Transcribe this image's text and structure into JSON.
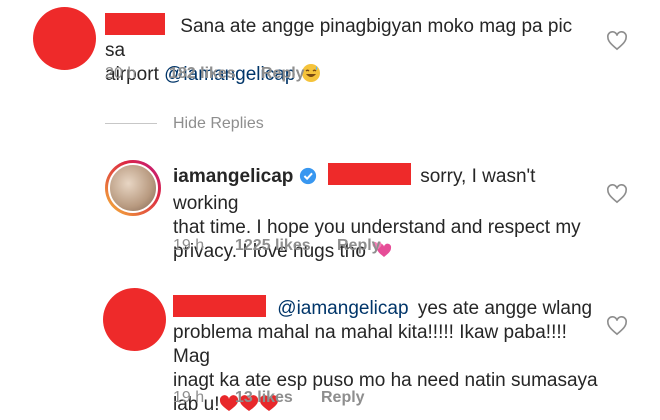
{
  "comments": [
    {
      "text": "Sana ate angge pinagbigyan moko mag pa pic sa",
      "text_line2_prefix": "airport ",
      "mention": "@iamangelicap",
      "emoji": "grinning-sweat",
      "time": "20 h",
      "likes": "182 likes",
      "reply": "Reply"
    },
    {
      "username": "iamangelicap",
      "text_line1": "sorry, I wasn't working",
      "text_line2": "that time. I hope you understand and respect my",
      "text_line3": "privacy. I love hugs tho",
      "emoji": "two-hearts",
      "time": "19 h",
      "likes": "1225 likes",
      "reply": "Reply"
    },
    {
      "mention": "@iamangelicap",
      "text_line1": "yes ate angge wlang",
      "text_line2": "problema mahal na mahal kita!!!!! Ikaw paba!!!! Mag",
      "text_line3": "inagt ka ate esp puso mo ha  need natin sumasaya",
      "text_line4": "lab u!",
      "emoji": "red-hearts",
      "time": "19 h",
      "likes": "13 likes",
      "reply": "Reply"
    }
  ],
  "hide_replies": "Hide Replies",
  "colors": {
    "redaction": "#ee2a2a",
    "mention": "#003569",
    "meta": "#8e8e8e",
    "text": "#262626"
  }
}
